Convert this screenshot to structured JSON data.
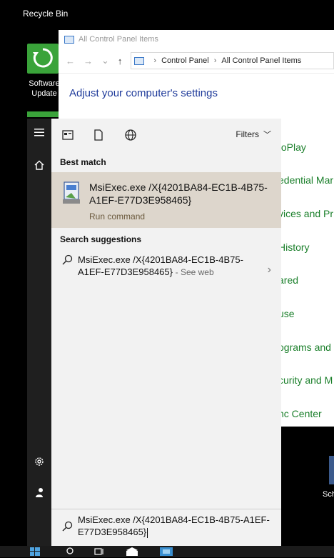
{
  "desktop": {
    "recycle_bin_label": "Recycle Bin",
    "software_update_label": "Software Update",
    "right_partial_label": "Sch"
  },
  "control_panel": {
    "window_title": "All Control Panel Items",
    "breadcrumb": [
      "Control Panel",
      "All Control Panel Items"
    ],
    "heading": "Adjust your computer's settings",
    "items_partial": [
      "toPlay",
      "edential Mar",
      "vices and Pr",
      "History",
      "ared",
      "use",
      "ograms and",
      "curity and M",
      "nc Center"
    ]
  },
  "start_panel": {
    "filters_label": "Filters",
    "best_match_label": "Best match",
    "best_match": {
      "title": "MsiExec.exe /X{4201BA84-EC1B-4B75-A1EF-E77D3E958465}",
      "subtitle": "Run command"
    },
    "suggestions_label": "Search suggestions",
    "suggestion": {
      "text": "MsiExec.exe /X{4201BA84-EC1B-4B75-A1EF-E77D3E958465}",
      "see_web": "- See web"
    },
    "search_value": "MsiExec.exe /X{4201BA84-EC1B-4B75-A1EF-E77D3E958465}"
  },
  "icons": {
    "rail": [
      "hamburger-icon",
      "home-icon",
      "gear-icon",
      "user-icon"
    ],
    "topbar": [
      "apps-icon",
      "document-icon",
      "globe-icon"
    ],
    "taskbar": [
      "windows-start-icon",
      "search-icon",
      "task-view-icon",
      "mail-icon",
      "app-icon"
    ]
  },
  "colors": {
    "accent_green": "#3aa33a",
    "link_blue": "#1e3a9a",
    "item_green": "#1a7f2a",
    "best_match_bg": "#ddd6cc"
  }
}
